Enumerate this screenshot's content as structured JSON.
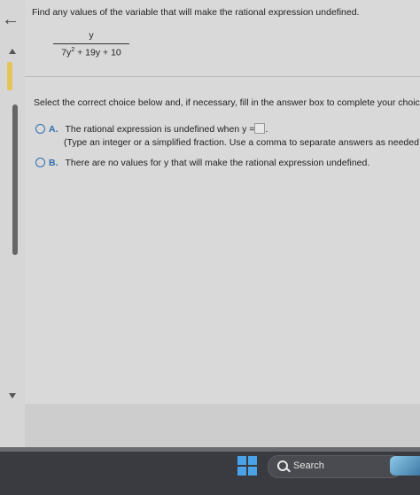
{
  "problem": {
    "prompt": "Find any values of the variable that will make the rational expression undefined.",
    "numerator": "y",
    "denominator_parts": [
      "7y",
      "2",
      " + 19y + 10"
    ]
  },
  "instruction": "Select the correct choice below and, if necessary, fill in the answer box to complete your choice.",
  "choices": [
    {
      "letter": "A.",
      "text": "The rational expression is undefined when y =",
      "after_box": ".",
      "hint": "(Type an integer or a simplified fraction. Use a comma to separate answers as needed.)",
      "answer_value": ""
    },
    {
      "letter": "B.",
      "text": "There are no values for y that will make the rational expression undefined."
    }
  ],
  "taskbar": {
    "search_label": "Search"
  },
  "icons": {
    "back": "arrow-left-icon",
    "start": "windows-start-icon",
    "search": "search-icon"
  },
  "colors": {
    "accent": "#2f6fb0",
    "taskbar": "#3a3b40"
  }
}
